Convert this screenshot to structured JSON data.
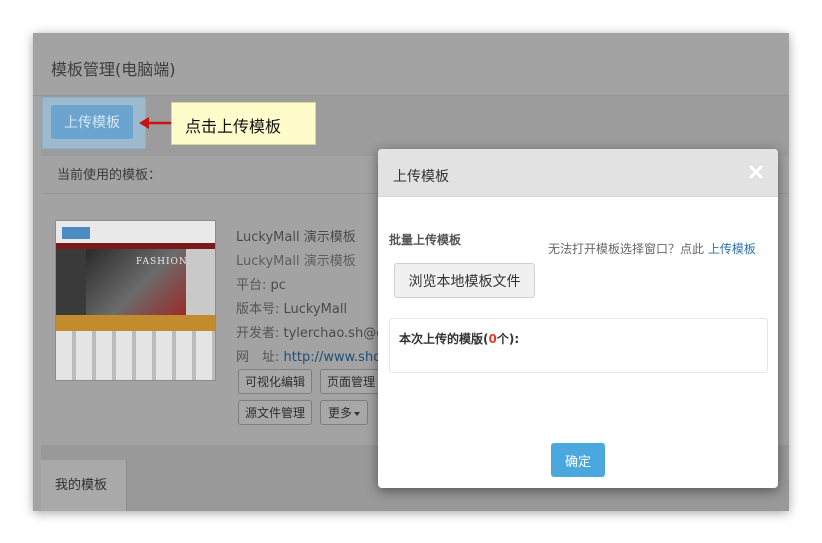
{
  "window": {
    "title": "模板管理(电脑端)"
  },
  "toolbar": {
    "upload_label": "上传模板"
  },
  "current": {
    "label": "当前使用的模板："
  },
  "template": {
    "name": "LuckyMall 演示模板",
    "desc": "LuckyMall 演示模板",
    "platform_label": "平台: ",
    "platform_value": "pc",
    "version_label": "版本号: ",
    "version_value": "LuckyMall",
    "developer_label": "开发者: ",
    "developer_value": "tylerchao.sh@gm",
    "site_label": "网　址: ",
    "site_value": "http://www.shope",
    "thumb_text": "FASHION"
  },
  "actions": {
    "visual_edit": "可视化编辑",
    "page_manage": "页面管理",
    "source_manage": "源文件管理",
    "more": "更多"
  },
  "tabs": {
    "mine": "我的模板"
  },
  "callout": {
    "text": "点击上传模板"
  },
  "modal": {
    "title": "上传模板",
    "batch_label": "批量上传模板",
    "hint_text": "无法打开模板选择窗口？点此 ",
    "hint_link": "上传模板",
    "browse_label": "浏览本地模板文件",
    "count_prefix": "本次上传的模版(",
    "count_value": "0",
    "count_suffix": "个):",
    "ok_label": "确定"
  },
  "colors": {
    "primary_button": "#4aa8df",
    "count_red": "#e03b2b",
    "callout_bg": "#fffccc",
    "arrow": "#cc1111"
  }
}
